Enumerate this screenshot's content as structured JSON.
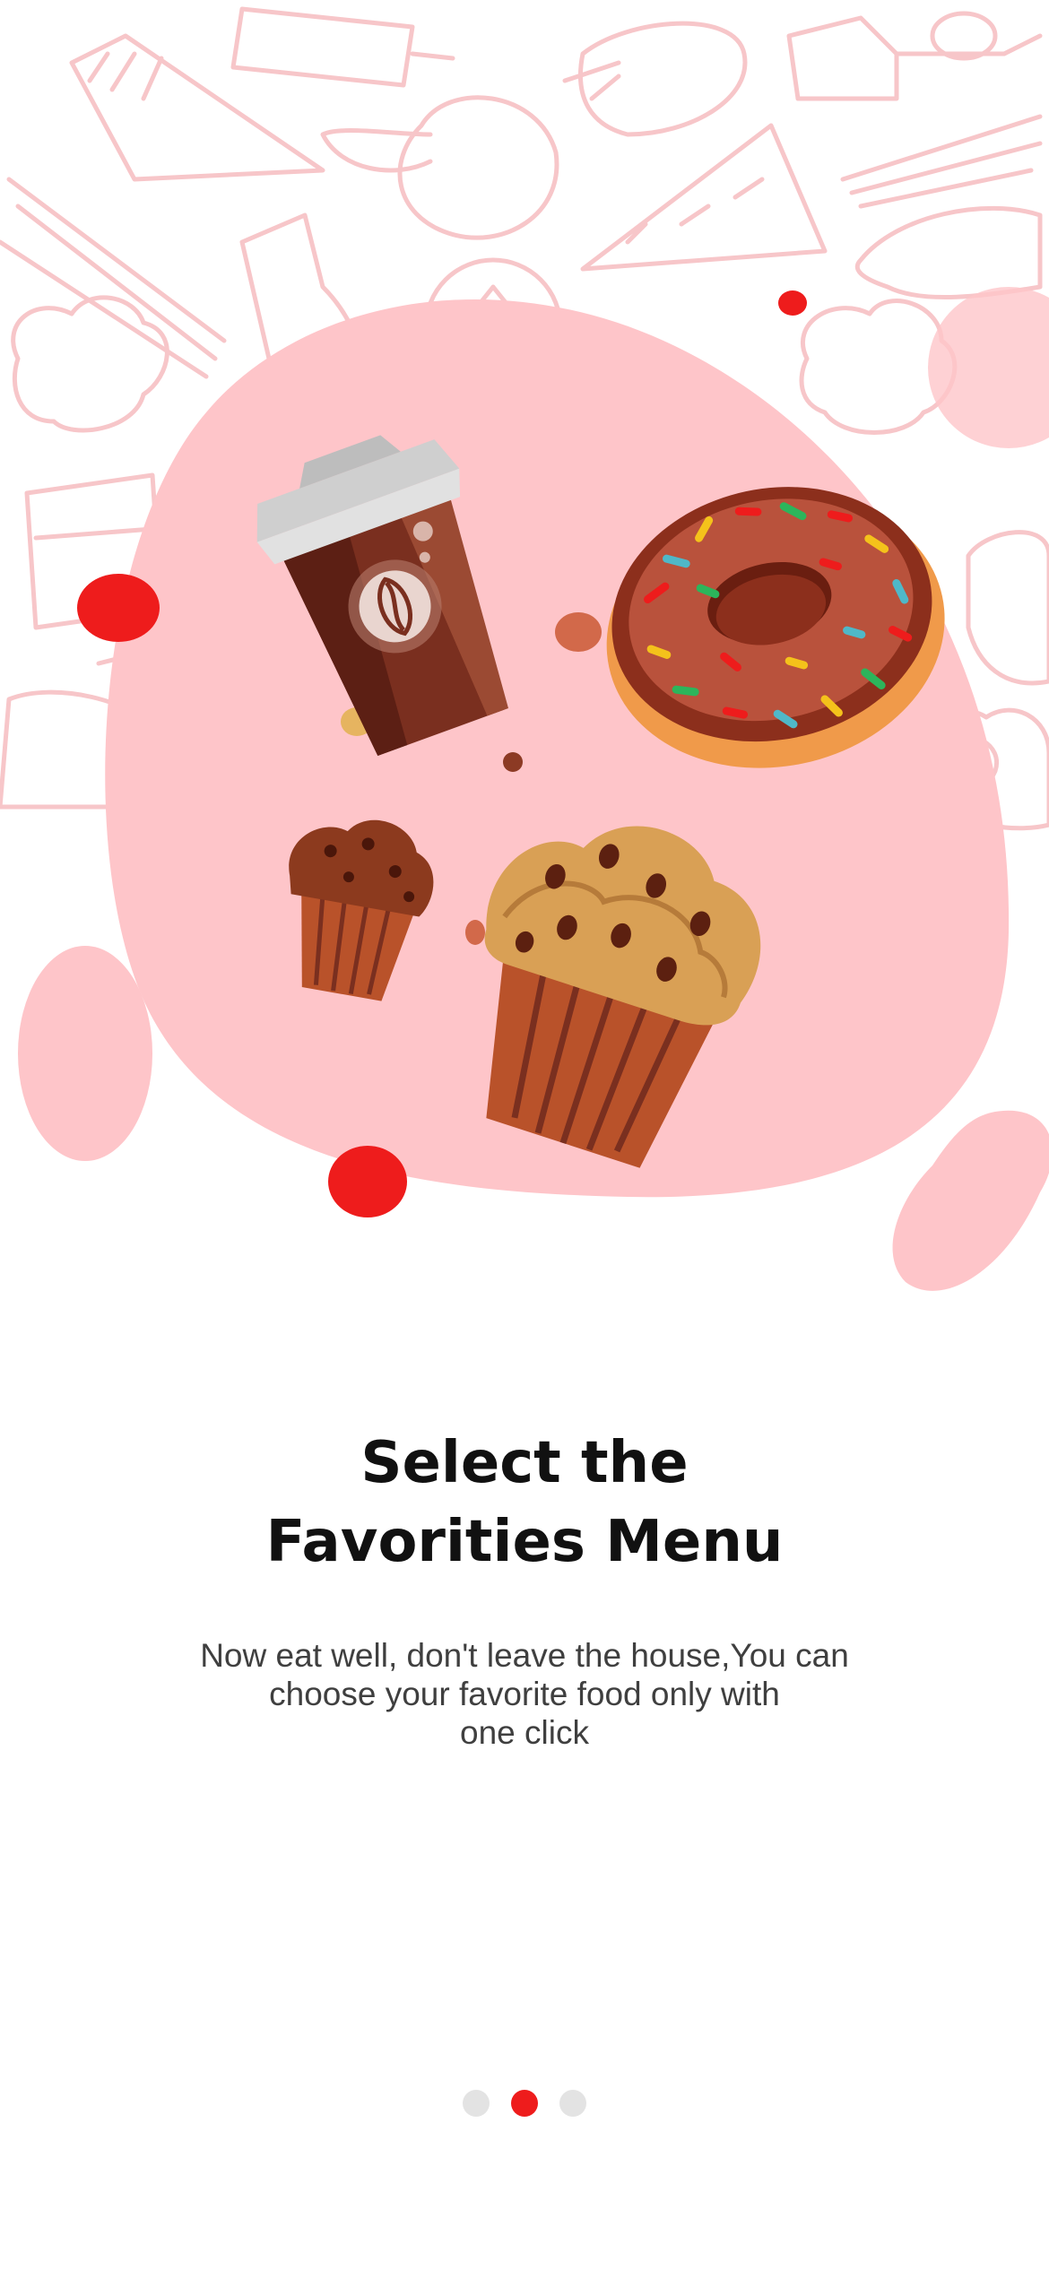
{
  "onboarding": {
    "title_line1": "Select the",
    "title_line2": "Favorities Menu",
    "description_line1": "Now eat well, don't leave the house,You can",
    "description_line2": "choose your favorite food only with",
    "description_line3": "one click",
    "illustration": {
      "items": [
        "coffee-cup",
        "donut",
        "muffin",
        "cupcake"
      ],
      "background_doodles": [
        "fries",
        "cone",
        "popsicle",
        "strawberry",
        "bottle",
        "apple",
        "pizza",
        "asparagus",
        "fish",
        "tomato",
        "broccoli",
        "cauliflower",
        "carrot",
        "chicken-leg"
      ]
    },
    "pager": {
      "total_pages": 3,
      "current_page": 2
    }
  },
  "colors": {
    "accent": "#ee1c1c",
    "blob_pink": "#fec5c9",
    "doodle_pink": "#f7c6c9",
    "dot_inactive": "#e3e3e3",
    "title_text": "#111111",
    "body_text": "#3f3f3f"
  }
}
